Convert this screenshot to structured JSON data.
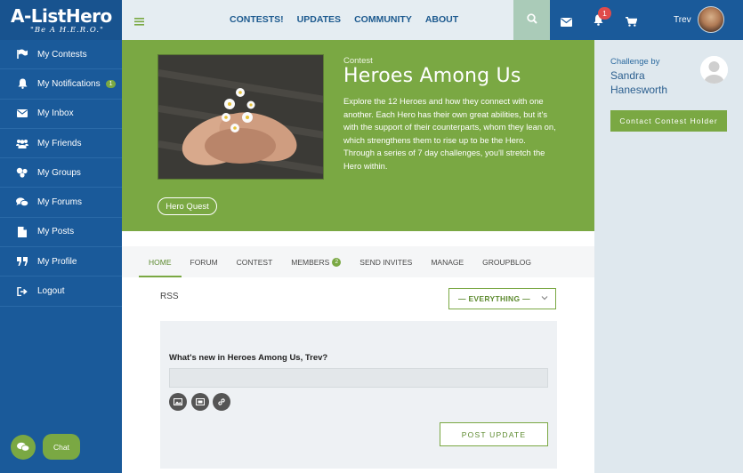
{
  "logo": {
    "brand": "A-ListHero",
    "tagline": "\"Be A H.E.R.O.\""
  },
  "sidebar": {
    "items": [
      {
        "label": "My Contests",
        "icon": "flag-icon"
      },
      {
        "label": "My Notifications",
        "icon": "bell-icon",
        "badge": "1"
      },
      {
        "label": "My Inbox",
        "icon": "envelope-icon"
      },
      {
        "label": "My Friends",
        "icon": "users-icon"
      },
      {
        "label": "My Groups",
        "icon": "group-icon"
      },
      {
        "label": "My Forums",
        "icon": "comments-icon"
      },
      {
        "label": "My Posts",
        "icon": "document-icon"
      },
      {
        "label": "My Profile",
        "icon": "quote-icon"
      },
      {
        "label": "Logout",
        "icon": "sign-out-icon"
      }
    ]
  },
  "topbar": {
    "nav": [
      "CONTESTS!",
      "UPDATES",
      "COMMUNITY",
      "ABOUT"
    ],
    "notification_count": "1",
    "user_name": "Trev"
  },
  "banner": {
    "eyebrow": "Contest",
    "title": "Heroes Among Us",
    "description": "Explore the 12 Heroes and how they connect with one another.  Each Hero has their own great abilities, but it's with the support of their counterparts, whom they lean on, which strengthens them to rise up to be the Hero. Through a series of 7 day challenges, you'll stretch the Hero within.",
    "tag_button": "Hero Quest"
  },
  "holder": {
    "challenge_by": "Challenge by",
    "name": "Sandra Hanesworth",
    "contact_button": "Contact Contest Holder"
  },
  "tabs": [
    {
      "label": "HOME"
    },
    {
      "label": "FORUM"
    },
    {
      "label": "CONTEST"
    },
    {
      "label": "MEMBERS",
      "count": "2"
    },
    {
      "label": "SEND INVITES"
    },
    {
      "label": "MANAGE"
    },
    {
      "label": "GROUPBLOG"
    }
  ],
  "activity": {
    "rss": "RSS",
    "filter_value": "— EVERYTHING —",
    "post_prompt": "What's new in Heroes Among Us, Trev?",
    "post_button": "POST UPDATE"
  },
  "chat": {
    "label": "Chat"
  },
  "colors": {
    "brand_blue": "#1a5a9a",
    "accent_green": "#7aa843",
    "badge_red": "#e04b4b"
  }
}
